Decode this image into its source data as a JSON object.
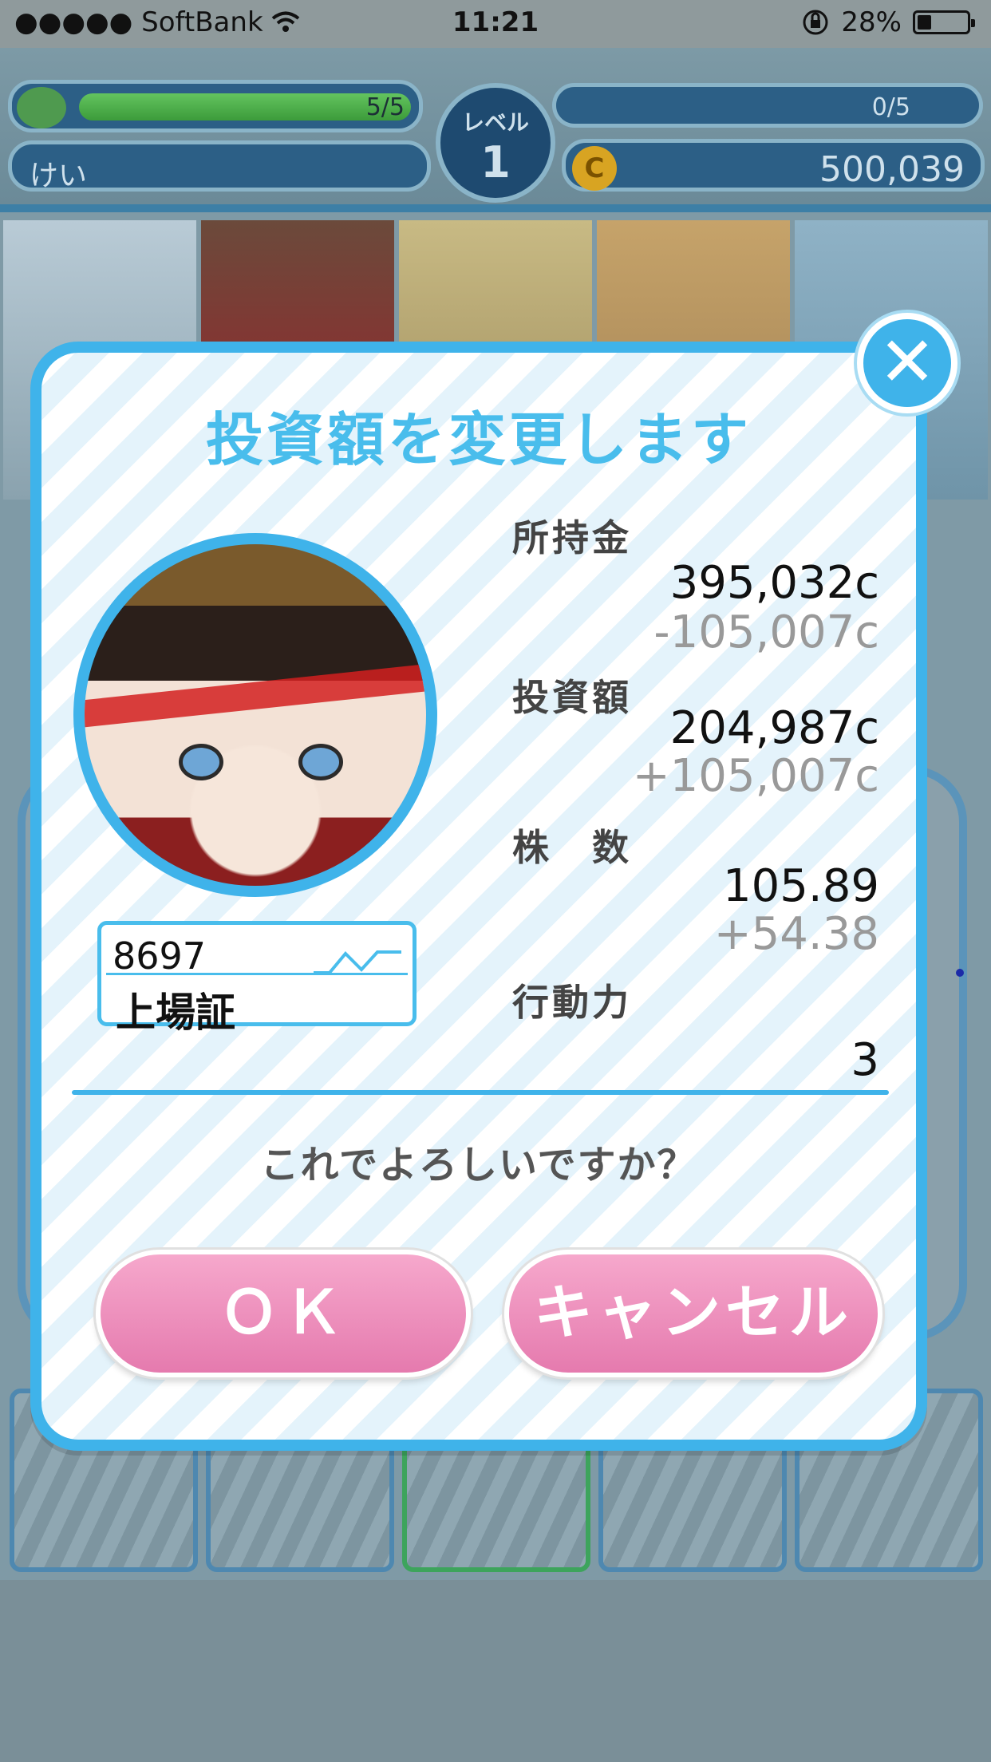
{
  "status_bar": {
    "carrier": "●●●●● SoftBank",
    "time": "11:21",
    "battery": "28%",
    "battery_level": 0.28
  },
  "header": {
    "stamina": "5/5",
    "stamina_level": 1.0,
    "player_name": "けい",
    "level_label": "レベル",
    "level_value": "1",
    "exp": "0/5",
    "coins": "500,039",
    "coin_symbol": "C"
  },
  "dialog": {
    "title": "投資額を変更します",
    "close_symbol": "✕",
    "stock": {
      "code": "8697",
      "name": "上場証"
    },
    "stats": {
      "funds_label": "所持金",
      "funds_value": "395,032c",
      "funds_delta": "-105,007c",
      "investment_label": "投資額",
      "investment_value": "204,987c",
      "investment_delta": "+105,007c",
      "shares_label": "株　数",
      "shares_value": "105.89",
      "shares_delta": "+54.38",
      "action_label": "行動力",
      "action_value": "3"
    },
    "confirm_text": "これでよろしいですか？",
    "ok_label": "ＯＫ",
    "cancel_label": "キャンセル"
  },
  "colors": {
    "accent": "#3fb3ea",
    "button_pink": "#e57aae",
    "header_blue": "#2c5f86"
  }
}
